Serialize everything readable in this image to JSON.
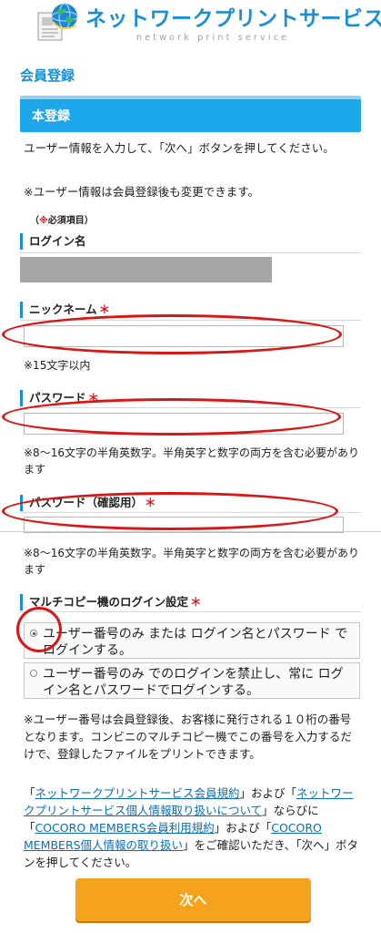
{
  "header": {
    "title": "ネットワークプリントサービス",
    "subtitle": "network print service",
    "logo_icon": "globe-document-icon"
  },
  "page_heading": "会員登録",
  "banner": "本登録",
  "intro": "ユーザー情報を入力して、「次へ」ボタンを押してください。",
  "note_change": "※ユーザー情報は会員登録後も変更できます。",
  "required_note": {
    "open": "（",
    "star": "※",
    "text": "必須項目）"
  },
  "login_name": {
    "label": "ログイン名"
  },
  "nickname": {
    "label": "ニックネーム",
    "required": "＊",
    "value": "",
    "note": "※15文字以内"
  },
  "password": {
    "label": "パスワード",
    "required": "＊",
    "value": "",
    "note": "※8〜16文字の半角英数字。半角英字と数字の両方を含む必要があります"
  },
  "password_confirm": {
    "label": "パスワード（確認用）",
    "required": "＊",
    "value": "",
    "note": "※8〜16文字の半角英数字。半角英字と数字の両方を含む必要があります"
  },
  "multicopy": {
    "label": "マルチコピー機のログイン設定",
    "required": "＊",
    "options": [
      {
        "label": "ユーザー番号のみ または ログイン名とパスワード でログインする。",
        "selected": true
      },
      {
        "label": "ユーザー番号のみ でのログインを禁止し、常に ログイン名とパスワードでログインする。",
        "selected": false
      }
    ]
  },
  "user_number_note": "※ユーザー番号は会員登録後、お客様に発行される１０桁の番号となります。コンビニのマルチコピー機でこの番号を入力するだけで、登録したファイルをプリントできます。",
  "terms": {
    "q1": "「",
    "link1": "ネットワークプリントサービス会員規約",
    "t1": "」および「",
    "link2": "ネットワークプリントサービス個人情報取り扱いについて",
    "t2": "」ならびに「",
    "link3": "COCORO MEMBERS会員利用規約",
    "t3": "」および「",
    "link4": "COCORO MEMBERS個人情報の取り扱い",
    "t4": "」をご確認いただき、「次へ」ボタンを押してください。"
  },
  "next_button": "次へ",
  "colors": {
    "brand_blue": "#1a8fd6",
    "banner_blue": "#1ba7ea",
    "required_red": "#e0161b",
    "annotation_red": "#d81616",
    "button_orange": "#f5a21c"
  }
}
